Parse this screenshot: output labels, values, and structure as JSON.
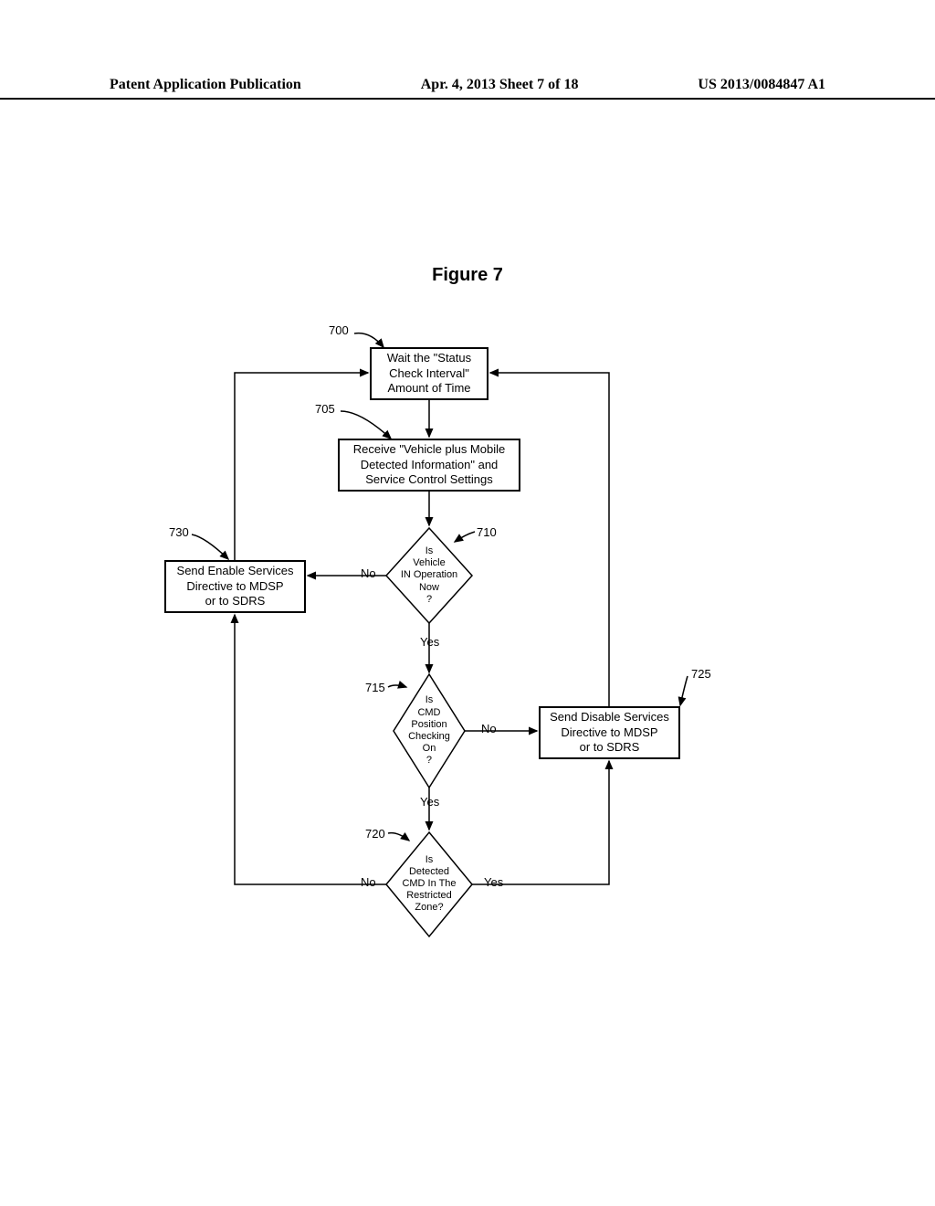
{
  "header": {
    "left": "Patent Application Publication",
    "center": "Apr. 4, 2013  Sheet 7 of 18",
    "right": "US 2013/0084847 A1"
  },
  "figure_title": "Figure 7",
  "refs": {
    "b700": "700",
    "b705": "705",
    "b710": "710",
    "b715": "715",
    "b720": "720",
    "b725": "725",
    "b730": "730"
  },
  "boxes": {
    "wait": "Wait the \"Status\nCheck Interval\"\nAmount of Time",
    "receive": "Receive \"Vehicle plus Mobile\nDetected Information\" and\nService Control Settings",
    "enable": "Send Enable Services\nDirective to MDSP\nor to SDRS",
    "disable": "Send Disable Services\nDirective to MDSP\nor to SDRS"
  },
  "diamonds": {
    "d710": "Is\nVehicle\nIN Operation\nNow\n?",
    "d715": "Is\nCMD\nPosition\nChecking\nOn\n?",
    "d720": "Is\nDetected\nCMD In The\nRestricted\nZone?"
  },
  "labels": {
    "yes": "Yes",
    "no": "No"
  }
}
